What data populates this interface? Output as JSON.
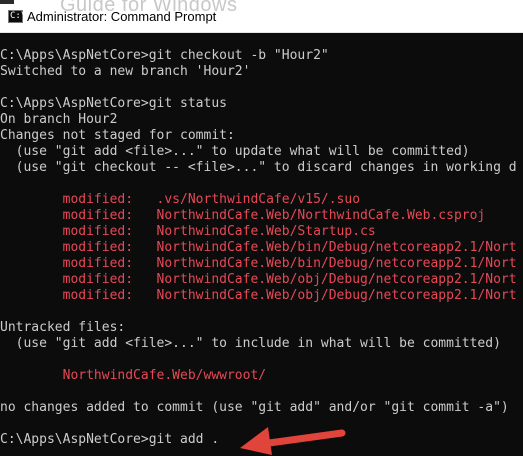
{
  "window": {
    "title": "Administrator: Command Prompt",
    "background_text": "Guide for Windows",
    "icon": "cmd-icon",
    "icon_glyph": "C:\\"
  },
  "colors": {
    "console_bg": "#0c0c0c",
    "console_text": "#cccccc",
    "modified_text": "#e74856",
    "arrow": "#e0443a"
  },
  "console": {
    "lines": [
      {
        "text": "C:\\Apps\\AspNetCore>git checkout -b \"Hour2\"",
        "style": "normal"
      },
      {
        "text": "Switched to a new branch 'Hour2'",
        "style": "normal"
      },
      {
        "text": "",
        "style": "normal"
      },
      {
        "text": "C:\\Apps\\AspNetCore>git status",
        "style": "normal"
      },
      {
        "text": "On branch Hour2",
        "style": "normal"
      },
      {
        "text": "Changes not staged for commit:",
        "style": "normal"
      },
      {
        "text": "  (use \"git add <file>...\" to update what will be committed)",
        "style": "normal"
      },
      {
        "text": "  (use \"git checkout -- <file>...\" to discard changes in working d",
        "style": "normal"
      },
      {
        "text": "",
        "style": "normal"
      },
      {
        "text": "        modified:   .vs/NorthwindCafe/v15/.suo",
        "style": "red"
      },
      {
        "text": "        modified:   NorthwindCafe.Web/NorthwindCafe.Web.csproj",
        "style": "red"
      },
      {
        "text": "        modified:   NorthwindCafe.Web/Startup.cs",
        "style": "red"
      },
      {
        "text": "        modified:   NorthwindCafe.Web/bin/Debug/netcoreapp2.1/Nort",
        "style": "red"
      },
      {
        "text": "        modified:   NorthwindCafe.Web/bin/Debug/netcoreapp2.1/Nort",
        "style": "red"
      },
      {
        "text": "        modified:   NorthwindCafe.Web/obj/Debug/netcoreapp2.1/Nort",
        "style": "red"
      },
      {
        "text": "        modified:   NorthwindCafe.Web/obj/Debug/netcoreapp2.1/Nort",
        "style": "red"
      },
      {
        "text": "",
        "style": "normal"
      },
      {
        "text": "Untracked files:",
        "style": "normal"
      },
      {
        "text": "  (use \"git add <file>...\" to include in what will be committed)",
        "style": "normal"
      },
      {
        "text": "",
        "style": "normal"
      },
      {
        "text": "        NorthwindCafe.Web/wwwroot/",
        "style": "red"
      },
      {
        "text": "",
        "style": "normal"
      },
      {
        "text": "no changes added to commit (use \"git add\" and/or \"git commit -a\")",
        "style": "normal"
      },
      {
        "text": "",
        "style": "normal"
      },
      {
        "text": "C:\\Apps\\AspNetCore>git add .",
        "style": "normal"
      }
    ]
  },
  "annotation": {
    "icon": "red-arrow-icon"
  }
}
